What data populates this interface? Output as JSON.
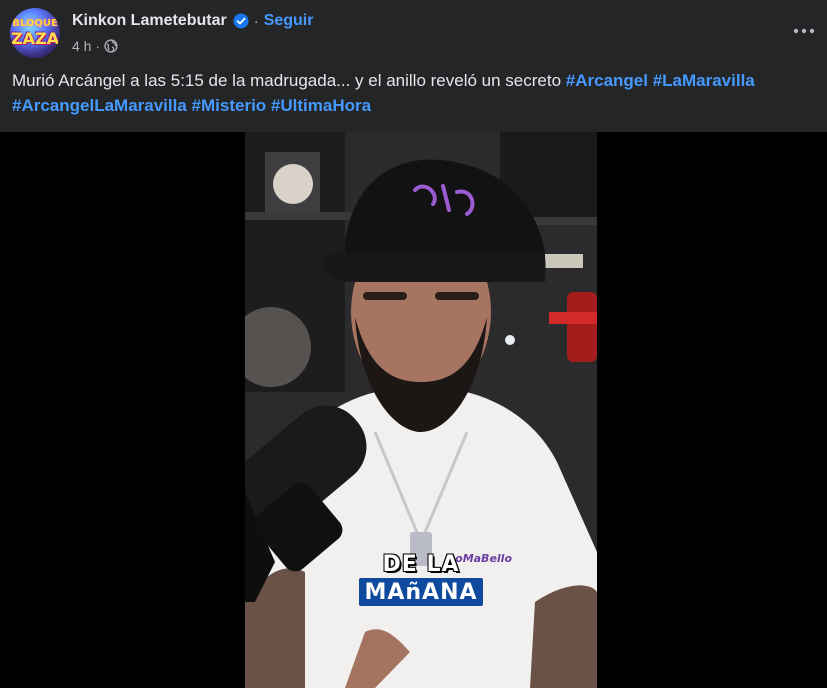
{
  "header": {
    "avatar_text_top": "BLOQUE",
    "avatar_text_bottom": "ZAZA",
    "page_name": "Kinkon Lametebutar",
    "verified_icon": "verified-badge-icon",
    "separator": "·",
    "follow_label": "Seguir",
    "time": "4 h",
    "meta_separator": "·",
    "privacy_icon": "globe-icon",
    "more_icon": "more-options-icon"
  },
  "caption": {
    "text": "Murió Arcángel a las 5:15 de la madrugada... y el anillo reveló un secreto ",
    "hashtags": [
      "#Arcangel",
      "#LaMaravilla",
      "#ArcangelLaMaravilla",
      "#Misterio",
      "#UltimaHora"
    ]
  },
  "video": {
    "cap_logo_text": "W",
    "shirt_text": "DoMaBello",
    "subtitle_line1": "DE LA",
    "subtitle_line2": "MAñANA"
  },
  "colors": {
    "background": "#242526",
    "link": "#4599ff",
    "subtitle_box": "#0f4a9e"
  }
}
